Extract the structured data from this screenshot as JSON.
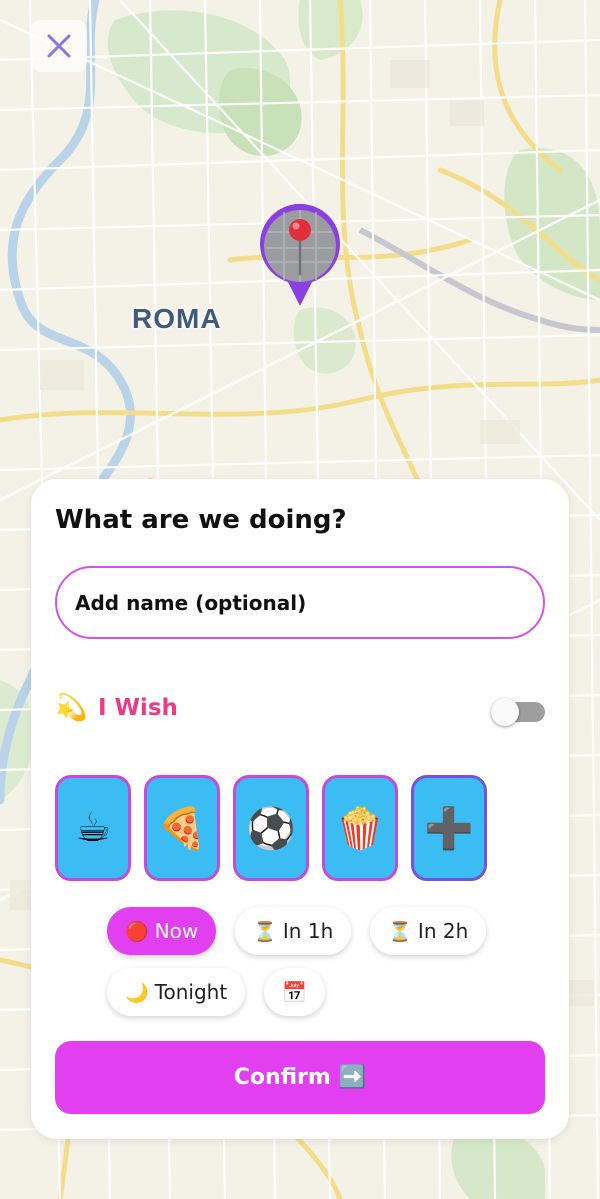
{
  "map": {
    "city_label": "ROMA",
    "pin_icon": "pushpin-icon"
  },
  "header": {
    "close_icon": "close-icon"
  },
  "sheet": {
    "title": "What are we doing?",
    "name_input": {
      "placeholder": "Add name (optional)",
      "value": ""
    },
    "wish": {
      "emoji": "💫",
      "label": "I Wish",
      "enabled": false
    },
    "activities": [
      {
        "icon": "coffee-icon",
        "emoji": "☕"
      },
      {
        "icon": "pizza-icon",
        "emoji": "🍕"
      },
      {
        "icon": "soccer-ball-icon",
        "emoji": "⚽"
      },
      {
        "icon": "popcorn-icon",
        "emoji": "🍿"
      },
      {
        "icon": "plus-icon",
        "emoji": "➕"
      }
    ],
    "times": [
      {
        "emoji": "🔴",
        "label": "Now",
        "selected": true
      },
      {
        "emoji": "⏳",
        "label": "In 1h",
        "selected": false
      },
      {
        "emoji": "⏳",
        "label": "In 2h",
        "selected": false
      },
      {
        "emoji": "🌙",
        "label": "Tonight",
        "selected": false
      },
      {
        "emoji": "📅",
        "label": "",
        "selected": false
      }
    ],
    "confirm": {
      "label": "Confirm",
      "emoji": "➡️"
    }
  },
  "colors": {
    "accent": "#e13ff0",
    "wish_pink": "#ea3b87",
    "tile_blue": "#3bbcf3",
    "tile_border": "#c44bd9"
  }
}
